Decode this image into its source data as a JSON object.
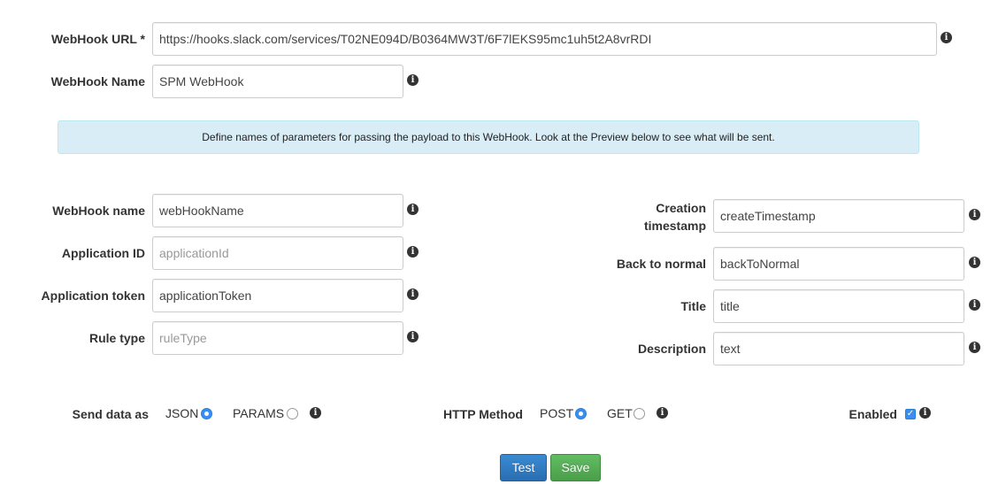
{
  "form": {
    "webhook_url": {
      "label": "WebHook URL *",
      "value": "https://hooks.slack.com/services/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"
    },
    "webhook_name": {
      "label": "WebHook Name",
      "value": "SPM WebHook"
    }
  },
  "notice": {
    "text": "Define names of parameters for passing the payload to this WebHook. Look at the Preview below to see what will be sent."
  },
  "params_left": [
    {
      "label": "WebHook name",
      "value": "webHookName",
      "placeholder": ""
    },
    {
      "label": "Application ID",
      "value": "",
      "placeholder": "applicationId"
    },
    {
      "label": "Application token",
      "value": "applicationToken",
      "placeholder": ""
    },
    {
      "label": "Rule type",
      "value": "",
      "placeholder": "ruleType"
    }
  ],
  "params_right": {
    "creation_label_line1": "Creation",
    "creation_label_line2": "timestamp",
    "creation_value": "createTimestamp",
    "fields": [
      {
        "label": "Back to normal",
        "value": "backToNormal",
        "placeholder": ""
      },
      {
        "label": "Title",
        "value": "title",
        "placeholder": ""
      },
      {
        "label": "Description",
        "value": "text",
        "placeholder": ""
      }
    ]
  },
  "options": {
    "send_data_as": {
      "label": "Send data as",
      "options": [
        "JSON",
        "PARAMS"
      ],
      "selected": "JSON"
    },
    "http_method": {
      "label": "HTTP Method",
      "options": [
        "POST",
        "GET"
      ],
      "selected": "POST"
    },
    "enabled": {
      "label": "Enabled",
      "checked": true
    }
  },
  "buttons": {
    "test_label": "Test",
    "save_label": "Save"
  },
  "icons": {
    "info": "info-icon"
  },
  "colors": {
    "primary": "#337ab7",
    "success": "#5cb85c",
    "info_bg": "#d9edf7"
  }
}
